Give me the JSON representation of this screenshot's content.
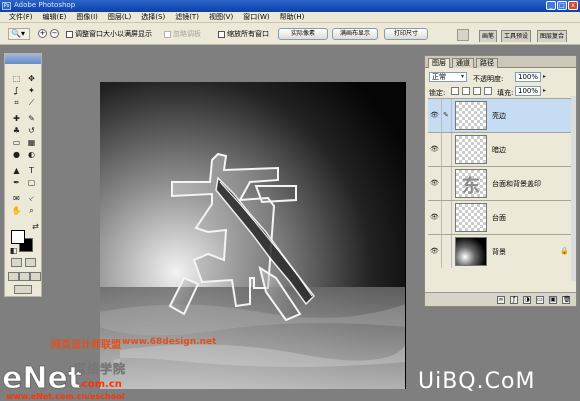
{
  "window": {
    "title": "Adobe Photoshop",
    "logo_text": "Ps",
    "minimize_label": "_",
    "maximize_label": "□",
    "close_label": "x"
  },
  "menu": [
    "文件(F)",
    "编辑(E)",
    "图像(I)",
    "图层(L)",
    "选择(S)",
    "滤镜(T)",
    "视图(V)",
    "窗口(W)",
    "帮助(H)"
  ],
  "options": {
    "tool_glyph": "🔍▾",
    "zoom_in": "+",
    "zoom_out": "−",
    "resize_windows": "调整窗口大小以满屏显示",
    "ignore_palettes": "忽略调板",
    "zoom_all_windows": "缩放所有窗口",
    "actual_pixels": "实际像素",
    "fit_on_screen": "满画布显示",
    "print_size": "打印尺寸"
  },
  "palette_well": {
    "brushes": "画笔",
    "tool_presets": "工具预设",
    "layer_comps": "图层复合"
  },
  "tools": {
    "marquee": "⬚",
    "move": "✥",
    "lasso": "ʆ",
    "magic_wand": "✦",
    "crop": "⌗",
    "slice": "⟋",
    "healing": "✚",
    "brush": "✎",
    "stamp": "♣",
    "history_brush": "↺",
    "eraser": "▭",
    "gradient": "▦",
    "blur": "●",
    "dodge": "◐",
    "path_select": "▲",
    "type": "T",
    "pen": "✒",
    "shape": "▢",
    "notes": "✉",
    "eyedropper": "⸔",
    "hand": "✋",
    "zoom": "⌕",
    "swap": "⇄",
    "default_colors": "◧"
  },
  "document": {
    "character": "东"
  },
  "watermark": {
    "site_name": "网页设计师联盟",
    "site_url": "www.68design.net",
    "enet": "eNet",
    "school": "网络学院",
    "school_domain": ".com.cn",
    "school_url": "www.eNet.com.cn/eschool",
    "uibq": "UiBQ.CoM"
  },
  "layers_panel": {
    "tabs": [
      "图层",
      "通道",
      "路径"
    ],
    "blend_mode": "正常",
    "opacity_label": "不透明度:",
    "opacity_value": "100%",
    "lock_label": "锁定:",
    "fill_label": "填充:",
    "fill_value": "100%",
    "eye_glyph": "👁",
    "brush_glyph": "✎",
    "lock_glyph": "🔒",
    "layers": [
      {
        "name": "亮边",
        "selected": true
      },
      {
        "name": "暗边",
        "selected": false
      },
      {
        "name": "台面和背景盖印",
        "selected": false
      },
      {
        "name": "台面",
        "selected": false
      },
      {
        "name": "背景",
        "selected": false
      }
    ],
    "bottom_icons": [
      "∞",
      "ƒ",
      "◑",
      "▭",
      "▣",
      "🗑"
    ]
  }
}
